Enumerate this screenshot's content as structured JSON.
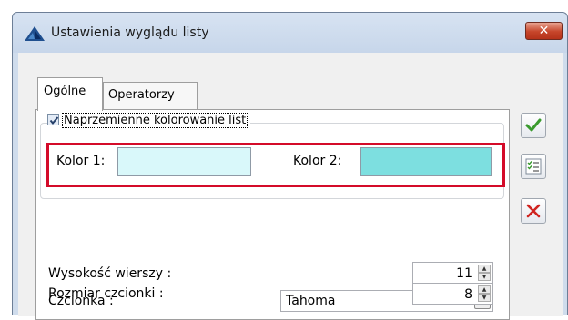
{
  "window": {
    "title": "Ustawienia wyglądu listy",
    "close_glyph": "✕"
  },
  "tabs": [
    {
      "label": "Ogólne",
      "active": true
    },
    {
      "label": "Operatorzy",
      "active": false
    }
  ],
  "alternating_colors": {
    "label": "Naprzemienne kolorowanie list",
    "checked": true,
    "color1": {
      "label": "Kolor 1:",
      "value": "#d9f8fa"
    },
    "color2": {
      "label": "Kolor 2:",
      "value": "#7ddfe0"
    },
    "highlight_color": "#d40b29"
  },
  "row_height": {
    "label": "Wysokość wierszy :",
    "value": "11"
  },
  "font": {
    "label": "Czcionka :",
    "value": "Tahoma"
  },
  "font_size": {
    "label": "Rozmiar czcionki :",
    "value": "8"
  },
  "side_buttons": [
    {
      "name": "confirm",
      "icon": "checkmark-icon"
    },
    {
      "name": "list",
      "icon": "checklist-icon"
    },
    {
      "name": "cancel",
      "icon": "cross-icon"
    }
  ]
}
